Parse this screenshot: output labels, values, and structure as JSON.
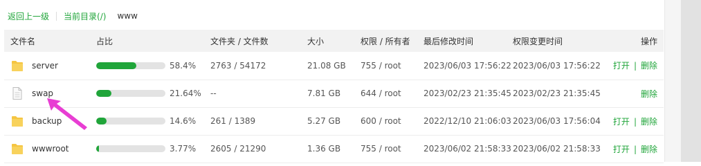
{
  "breadcrumb": {
    "back_label": "返回上一级",
    "current_label": "当前目录(/)",
    "dir": "www"
  },
  "columns": {
    "name": "文件名",
    "usage": "占比",
    "counts": "文件夹 / 文件数",
    "size": "大小",
    "perm": "权限 / 所有者",
    "mtime": "最后修改时间",
    "ctime": "权限变更时间",
    "ops": "操作"
  },
  "ops": {
    "open": "打开",
    "sep": "|",
    "delete": "删除"
  },
  "rows": [
    {
      "type": "folder",
      "icon": "folder-icon",
      "name": "server",
      "percent": 58.4,
      "percent_label": "58.4%",
      "counts": "2763 / 54172",
      "size": "21.08 GB",
      "perm": "755 / root",
      "mtime": "2023/06/03 17:56:22",
      "ctime": "2023/06/03 17:56:22"
    },
    {
      "type": "file",
      "icon": "file-icon",
      "name": "swap",
      "percent": 21.64,
      "percent_label": "21.64%",
      "counts": "--",
      "size": "7.81 GB",
      "perm": "644 / root",
      "mtime": "2023/02/23 21:35:45",
      "ctime": "2023/02/23 21:35:45"
    },
    {
      "type": "folder",
      "icon": "folder-icon",
      "name": "backup",
      "percent": 14.6,
      "percent_label": "14.6%",
      "counts": "261 / 1389",
      "size": "5.27 GB",
      "perm": "600 / root",
      "mtime": "2022/12/10 21:06:03",
      "ctime": "2023/06/03 17:56:04"
    },
    {
      "type": "folder",
      "icon": "folder-icon",
      "name": "wwwroot",
      "percent": 3.77,
      "percent_label": "3.77%",
      "counts": "2605 / 21290",
      "size": "1.36 GB",
      "perm": "755 / root",
      "mtime": "2023/06/02 21:58:33",
      "ctime": "2023/06/02 21:58:33"
    }
  ],
  "colors": {
    "accent": "#20a53a",
    "arrow": "#e83ed3",
    "folder": "#f5c542"
  },
  "annotation_icon": "arrow-annotation-icon"
}
